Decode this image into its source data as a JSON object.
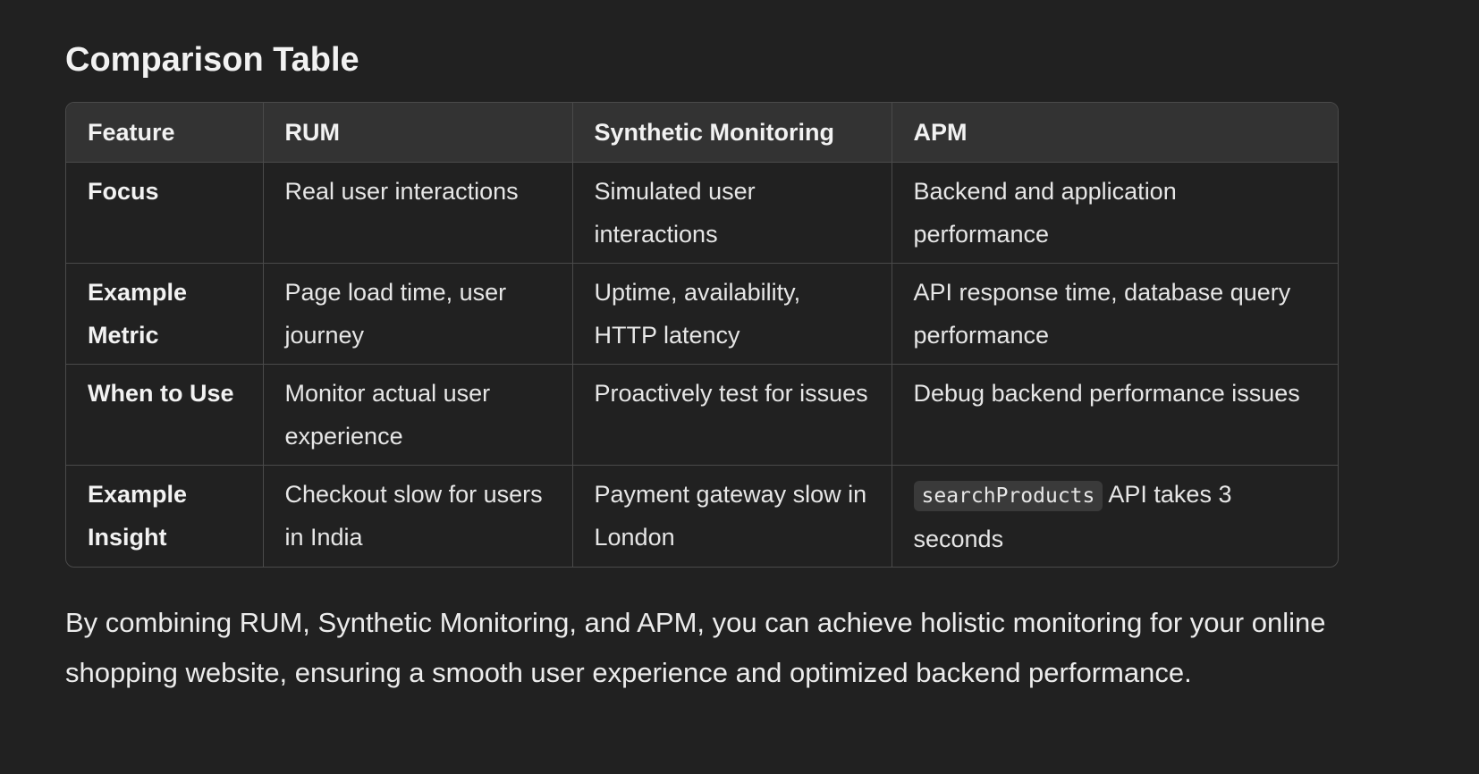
{
  "heading": "Comparison Table",
  "table": {
    "headers": [
      "Feature",
      "RUM",
      "Synthetic Monitoring",
      "APM"
    ],
    "rows": [
      {
        "feature": "Focus",
        "rum": "Real user interactions",
        "synthetic": "Simulated user interactions",
        "apm": "Backend and application performance"
      },
      {
        "feature": "Example Metric",
        "rum": "Page load time, user journey",
        "synthetic": "Uptime, availability, HTTP latency",
        "apm": "API response time, database query performance"
      },
      {
        "feature": "When to Use",
        "rum": "Monitor actual user experience",
        "synthetic": "Proactively test for issues",
        "apm": "Debug backend performance issues"
      },
      {
        "feature": "Example Insight",
        "rum": "Checkout slow for users in India",
        "synthetic": "Payment gateway slow in London",
        "apm_code": "searchProducts",
        "apm_rest": " API takes 3 seconds"
      }
    ]
  },
  "paragraph": "By combining RUM, Synthetic Monitoring, and APM, you can achieve holistic monitoring for your online shopping website, ensuring a smooth user experience and optimized backend performance.",
  "colors": {
    "background": "#212121",
    "header_bg": "#333333",
    "border": "#4a4a4a",
    "text": "#ececec",
    "code_bg": "#3a3a3a"
  }
}
